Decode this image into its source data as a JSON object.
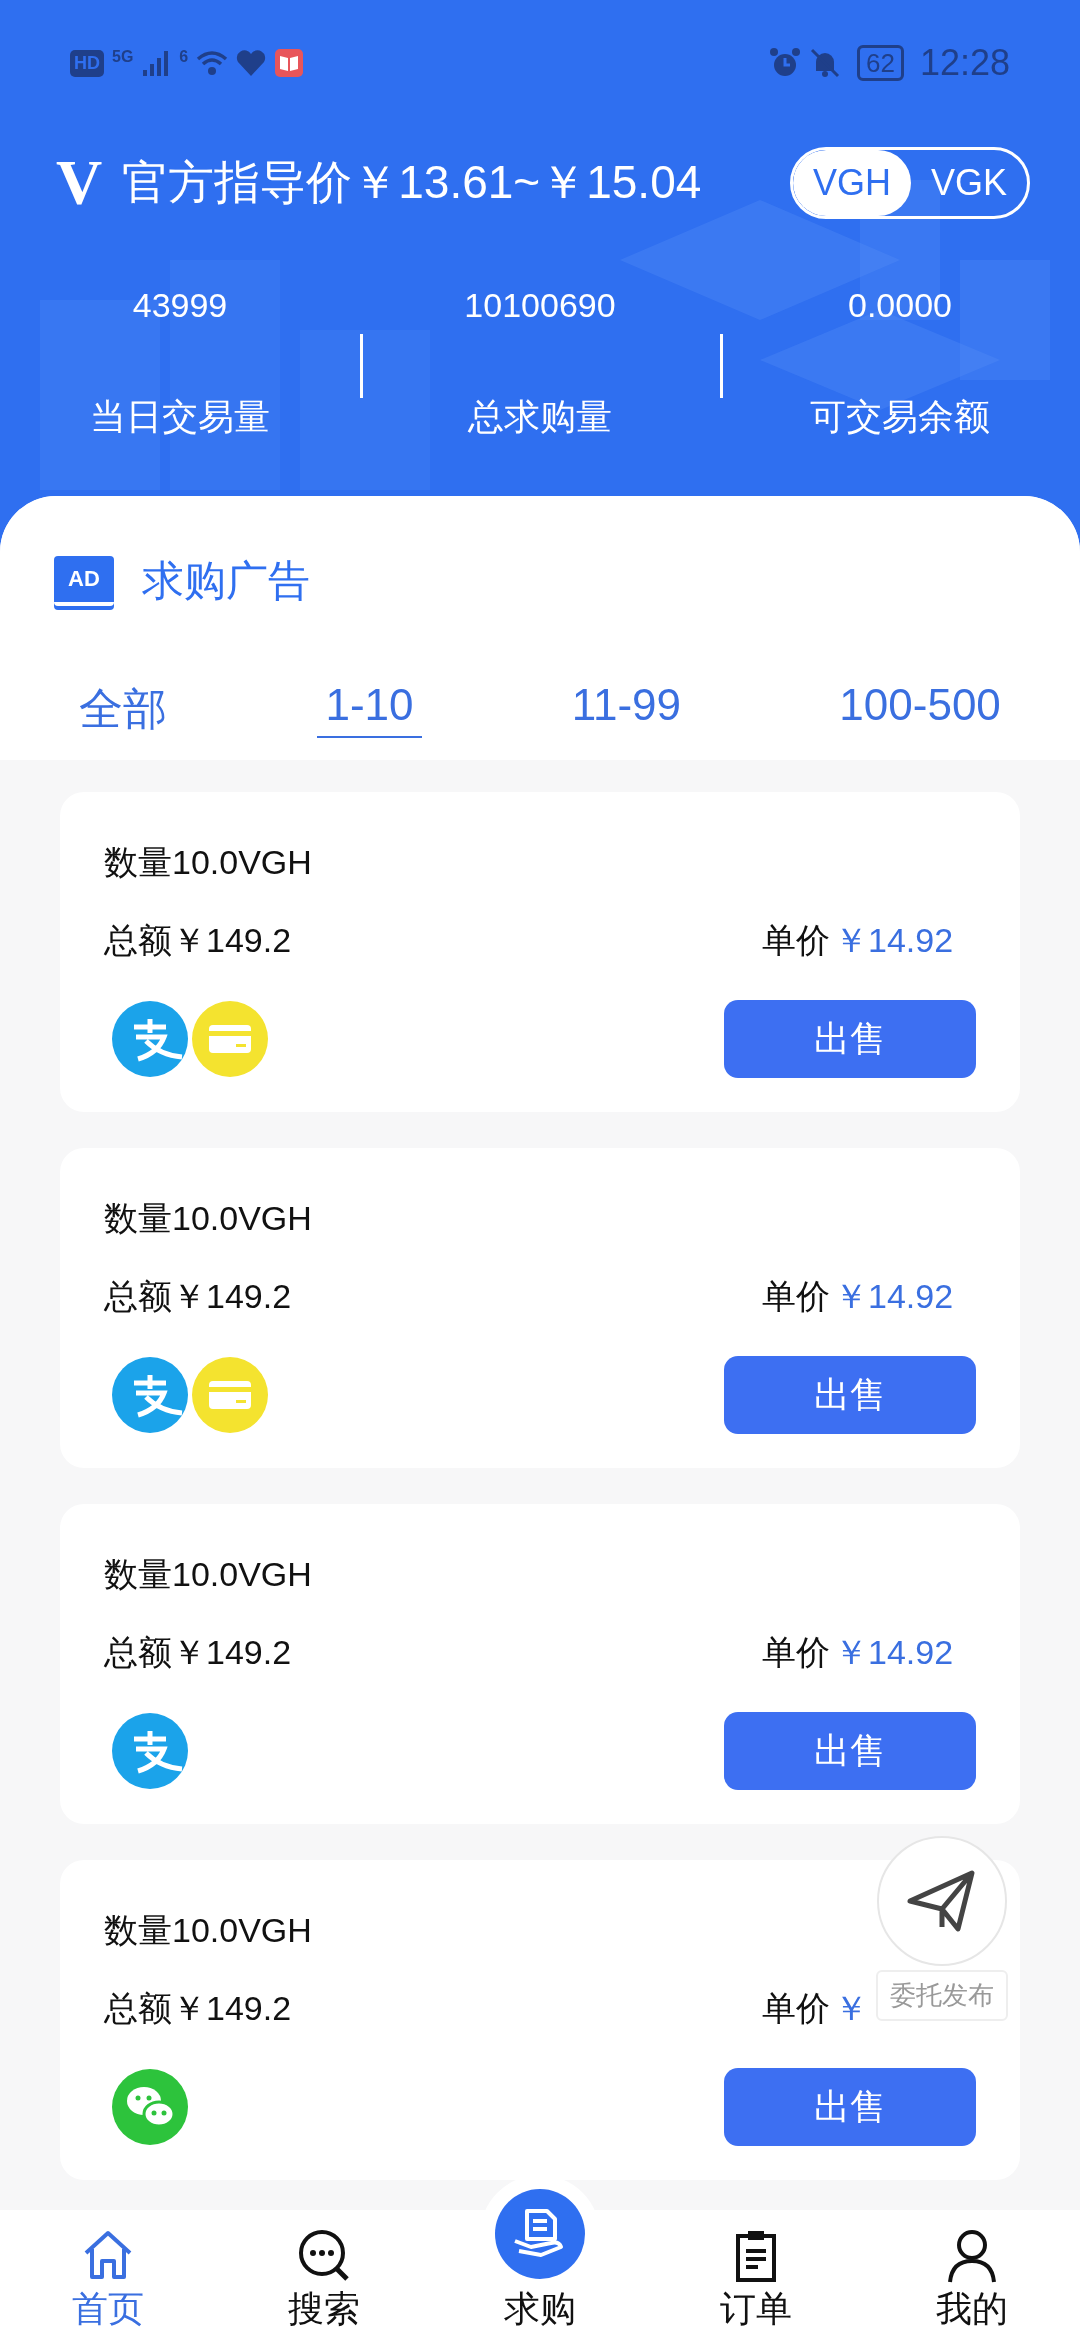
{
  "status_bar": {
    "hd": "HD",
    "network": "5G",
    "wifi": "6",
    "battery": "62",
    "time": "12:28"
  },
  "header": {
    "logo": "V",
    "title": "官方指导价￥13.61~￥15.04",
    "coins": [
      {
        "label": "VGH",
        "selected": true
      },
      {
        "label": "VGK",
        "selected": false
      }
    ]
  },
  "stats": [
    {
      "value": "43999",
      "label": "当日交易量"
    },
    {
      "value": "10100690",
      "label": "总求购量"
    },
    {
      "value": "0.0000",
      "label": "可交易余额"
    }
  ],
  "section": {
    "badge": "AD",
    "title": "求购广告"
  },
  "tabs": [
    {
      "label": "全部",
      "selected": false
    },
    {
      "label": "1-10",
      "selected": true
    },
    {
      "label": "11-99",
      "selected": false
    },
    {
      "label": "100-500",
      "selected": false
    }
  ],
  "ads": [
    {
      "quantity": "数量10.0VGH",
      "total": "总额￥149.2",
      "price_label": "单价",
      "price": "￥14.92",
      "payments": [
        {
          "kind": "alipay"
        },
        {
          "kind": "card"
        }
      ],
      "button": "出售"
    },
    {
      "quantity": "数量10.0VGH",
      "total": "总额￥149.2",
      "price_label": "单价",
      "price": "￥14.92",
      "payments": [
        {
          "kind": "alipay"
        },
        {
          "kind": "card"
        }
      ],
      "button": "出售"
    },
    {
      "quantity": "数量10.0VGH",
      "total": "总额￥149.2",
      "price_label": "单价",
      "price": "￥14.92",
      "payments": [
        {
          "kind": "alipay"
        }
      ],
      "button": "出售"
    },
    {
      "quantity": "数量10.0VGH",
      "total": "总额￥149.2",
      "price_label": "单价",
      "price": "￥",
      "payments": [
        {
          "kind": "wechat"
        }
      ],
      "button": "出售"
    }
  ],
  "floating_button": {
    "label": "委托发布"
  },
  "bottom_nav": [
    {
      "kind": "home",
      "label": "首页",
      "selected": true
    },
    {
      "kind": "search",
      "label": "搜索",
      "selected": false
    },
    {
      "kind": "buy",
      "label": "求购",
      "selected": false
    },
    {
      "kind": "orders",
      "label": "订单",
      "selected": false
    },
    {
      "kind": "profile",
      "label": "我的",
      "selected": false
    }
  ]
}
